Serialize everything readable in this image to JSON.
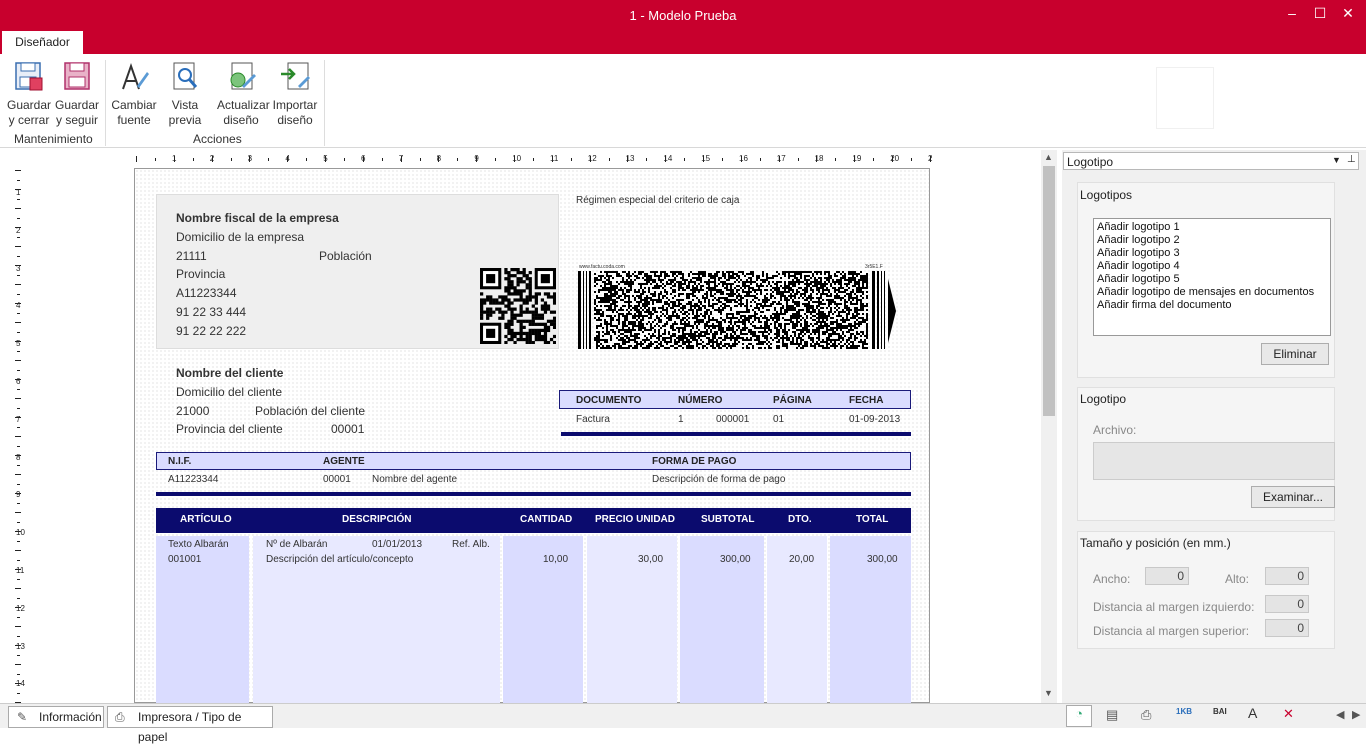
{
  "window": {
    "title": "1 - Modelo Prueba",
    "tab": "Diseñador"
  },
  "ribbon": {
    "buttons": [
      {
        "line1": "Guardar",
        "line2": "y cerrar"
      },
      {
        "line1": "Guardar",
        "line2": "y seguir"
      },
      {
        "line1": "Cambiar",
        "line2": "fuente"
      },
      {
        "line1": "Vista",
        "line2": "previa"
      },
      {
        "line1": "Actualizar",
        "line2": "diseño"
      },
      {
        "line1": "Importar",
        "line2": "diseño"
      }
    ],
    "groups": [
      "Mantenimiento",
      "Acciones"
    ]
  },
  "ruler": {
    "top": [
      "1",
      "2",
      "3",
      "4",
      "5",
      "6",
      "7",
      "8",
      "9",
      "10",
      "11",
      "12",
      "13",
      "14",
      "15",
      "16",
      "17",
      "18",
      "19",
      "20",
      "2"
    ],
    "left": [
      "1",
      "2",
      "3",
      "4",
      "5",
      "6",
      "7",
      "8",
      "9",
      "10",
      "11",
      "12",
      "13",
      "14"
    ]
  },
  "doc": {
    "company": {
      "name": "Nombre fiscal de la empresa",
      "address": "Domicilio de la empresa",
      "zip": "21111",
      "city": "Población",
      "province": "Provincia",
      "nif": "A11223344",
      "phone1": "91 22 33 444",
      "phone2": "91 22 22 222"
    },
    "regimen": "Régimen especial del criterio de caja",
    "barcode_left": "www.factu.coda.com",
    "barcode_right": "3r5E1.F",
    "client": {
      "name": "Nombre del cliente",
      "address": "Domicilio del cliente",
      "zip": "21000",
      "city": "Población del cliente",
      "province": "Provincia del cliente",
      "code": "00001"
    },
    "docbox": {
      "h_doc": "DOCUMENTO",
      "h_num": "NÚMERO",
      "h_page": "PÁGINA",
      "h_date": "FECHA",
      "doc": "Factura",
      "serie": "1",
      "num": "000001",
      "page": "01",
      "date": "01-09-2013"
    },
    "agent": {
      "h_nif": "N.I.F.",
      "h_agent": "AGENTE",
      "h_pay": "FORMA DE PAGO",
      "nif": "A11223344",
      "code": "00001",
      "name": "Nombre del agente",
      "pay": "Descripción de forma de pago"
    },
    "table": {
      "headers": [
        "ARTÍCULO",
        "DESCRIPCIÓN",
        "CANTIDAD",
        "PRECIO UNIDAD",
        "SUBTOTAL",
        "DTO.",
        "TOTAL"
      ],
      "albaran_text": "Texto Albarán",
      "albaran_num": "Nº de Albarán",
      "albaran_date": "01/01/2013",
      "albaran_ref": "Ref. Alb.",
      "article": "001001",
      "description": "Descripción del artículo/concepto",
      "qty": "10,00",
      "price": "30,00",
      "subtotal": "300,00",
      "dto": "20,00",
      "total": "300,00"
    }
  },
  "panel": {
    "selector": "Logotipo",
    "logos_title": "Logotipos",
    "logos": [
      "Añadir logotipo 1",
      "Añadir logotipo 2",
      "Añadir logotipo 3",
      "Añadir logotipo 4",
      "Añadir logotipo 5",
      "Añadir logotipo de mensajes en documentos",
      "Añadir firma del documento"
    ],
    "delete": "Eliminar",
    "logo_title": "Logotipo",
    "file_label": "Archivo:",
    "browse": "Examinar...",
    "size_title": "Tamaño y posición (en mm.)",
    "width_label": "Ancho:",
    "width": "0",
    "height_label": "Alto:",
    "height": "0",
    "left_label": "Distancia al margen izquierdo:",
    "left": "0",
    "top_label": "Distancia al margen superior:",
    "top": "0"
  },
  "bottom": {
    "tab1": "Información",
    "tab2": "Impresora / Tipo de papel"
  },
  "colors": {
    "brand": "#c8002d",
    "navy": "#0b0b6e",
    "lavender": "#dadcff"
  }
}
